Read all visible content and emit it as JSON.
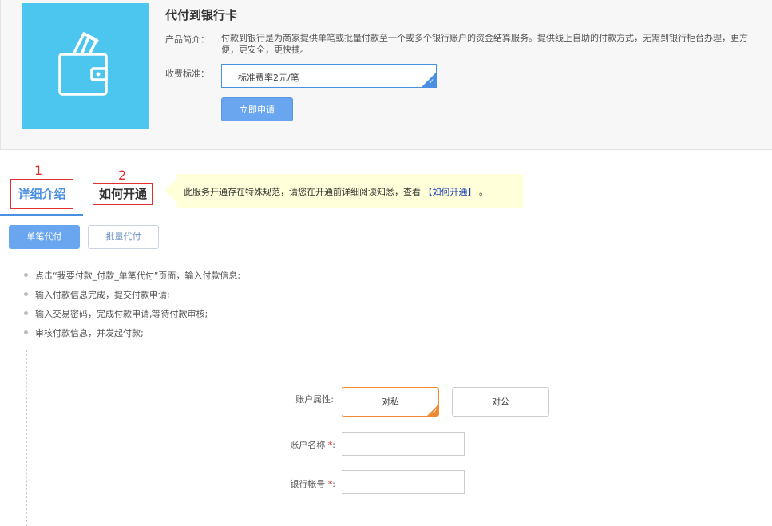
{
  "product": {
    "title": "代付到银行卡",
    "intro_label": "产品简介：",
    "intro_text": "付款到银行是为商家提供单笔或批量付款至一个或多个银行账户的资金结算服务。提供线上自助的付款方式，无需到银行柜台办理，更方便，更安全，更快捷。",
    "fee_label": "收费标准：",
    "fee_value": "标准费率2元/笔",
    "apply_button": "立即申请",
    "image_icon": "wallet-icon",
    "accent_color": "#4cc6ee"
  },
  "annotations": {
    "step1": "1",
    "step2": "2"
  },
  "tabs": [
    {
      "label": "详细介绍",
      "active": true
    },
    {
      "label": "如何开通",
      "active": false
    }
  ],
  "notice": {
    "text": "此服务开通存在特殊规范，请您在开通前详细阅读知悉，查看",
    "link": "【如何开通】",
    "suffix": "。"
  },
  "sub_tabs": {
    "single": "单笔代付",
    "batch": "批量代付"
  },
  "steps": [
    "点击“我要付款_付款_单笔代付”页面，输入付款信息;",
    "输入付款信息完成，提交付款申请;",
    "输入交易密码，完成付款申请,等待付款审核;",
    "审核付款信息，并发起付款;"
  ],
  "form": {
    "account_type_label": "账户属性:",
    "option_private": "对私",
    "option_public": "对公",
    "account_name_label": "账户名称",
    "bank_account_label": "银行帐号",
    "required_mark": "*",
    "colon": ":"
  }
}
